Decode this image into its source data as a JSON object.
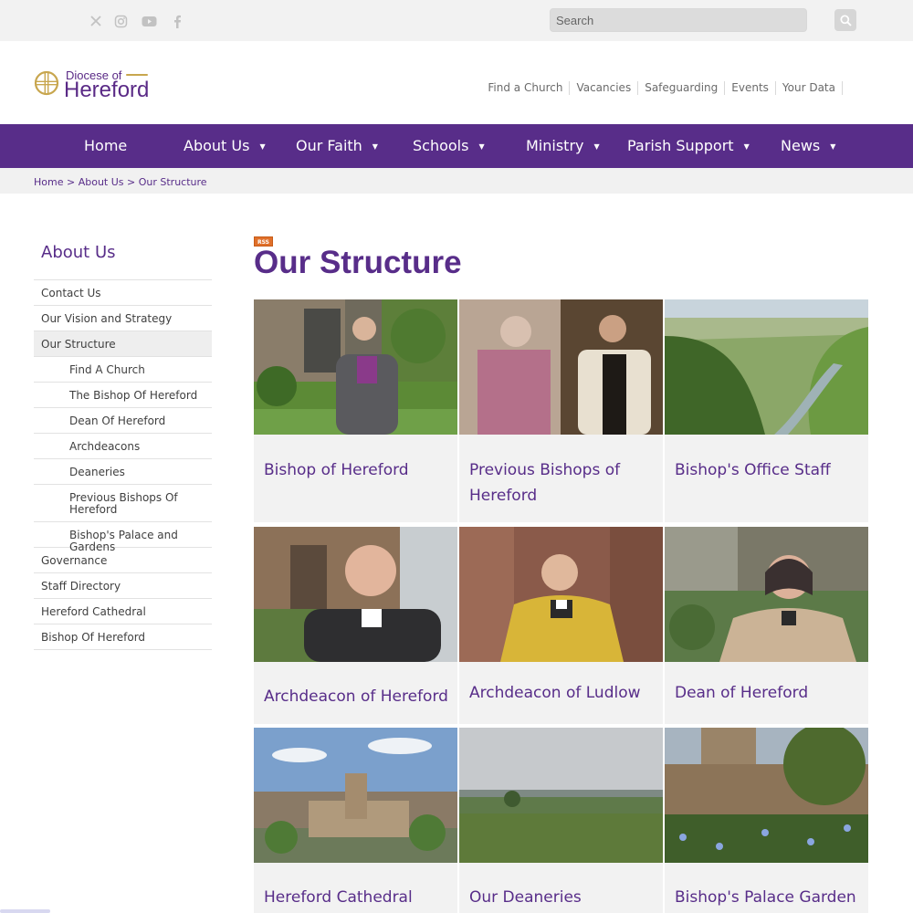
{
  "social": {
    "items": [
      "x-icon",
      "instagram-icon",
      "youtube-icon",
      "facebook-icon"
    ]
  },
  "search": {
    "placeholder": "Search"
  },
  "logo": {
    "small": "Diocese of",
    "big": "Hereford"
  },
  "utility_links": [
    "Find a Church",
    "Vacancies",
    "Safeguarding",
    "Events",
    "Your Data"
  ],
  "nav": {
    "items": [
      {
        "label": "Home",
        "dropdown": false
      },
      {
        "label": "About Us",
        "dropdown": true
      },
      {
        "label": "Our Faith",
        "dropdown": true
      },
      {
        "label": "Schools",
        "dropdown": true
      },
      {
        "label": "Ministry",
        "dropdown": true
      },
      {
        "label": "Parish Support",
        "dropdown": true
      },
      {
        "label": "News",
        "dropdown": true
      }
    ],
    "arrow": "▼"
  },
  "breadcrumb": {
    "home": "Home",
    "sep1": " > ",
    "about": "About Us",
    "sep2": " > ",
    "current": "Our Structure"
  },
  "sidebar": {
    "title": "About Us",
    "items": [
      "Contact Us",
      "Our Vision and Strategy",
      "Our Structure",
      "Find A Church",
      "The Bishop Of Hereford",
      "Dean Of Hereford",
      "Archdeacons",
      "Deaneries",
      "Previous Bishops Of Hereford",
      "Bishop's Palace and Gardens",
      "Governance",
      "Staff Directory",
      "Hereford Cathedral",
      "Bishop Of Hereford"
    ]
  },
  "rss": {
    "label": "RSS"
  },
  "page": {
    "title": "Our Structure"
  },
  "cards": [
    {
      "title": "Bishop of Hereford"
    },
    {
      "title": "Previous Bishops of Hereford"
    },
    {
      "title": "Bishop's Office Staff"
    },
    {
      "title": "Archdeacon of Hereford"
    },
    {
      "title": "Archdeacon of Ludlow"
    },
    {
      "title": "Dean of Hereford"
    },
    {
      "title": "Hereford Cathedral"
    },
    {
      "title": "Our Deaneries"
    },
    {
      "title": "Bishop's Palace Garden"
    }
  ],
  "colors": {
    "brand_purple": "#582d89",
    "logo_gold": "#c8a64e",
    "rss_orange": "#e0702a"
  }
}
